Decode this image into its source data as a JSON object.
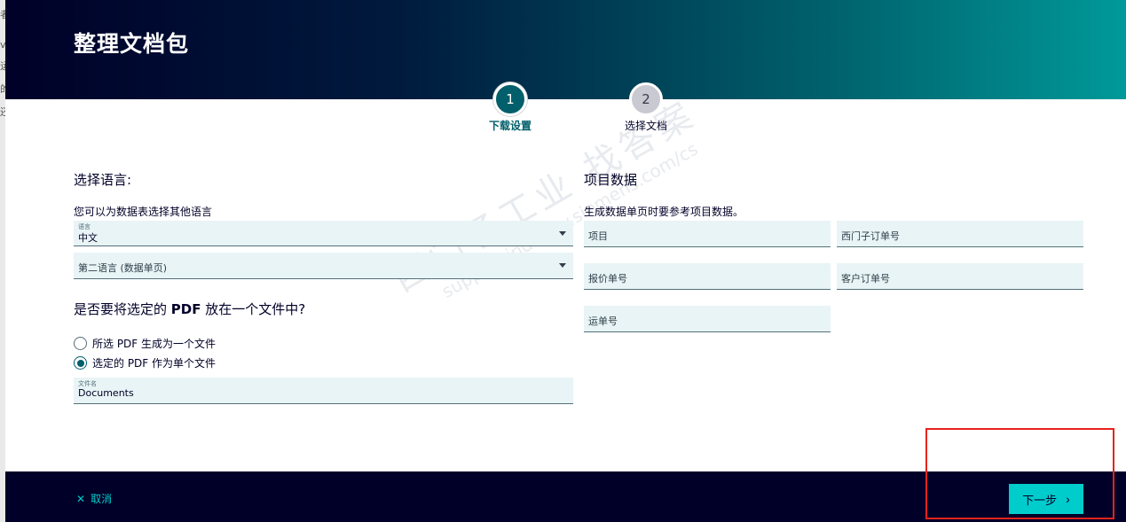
{
  "background_page": {
    "fragments": [
      "者",
      "v",
      "运",
      "的",
      "还"
    ]
  },
  "header": {
    "title": "整理文档包"
  },
  "stepper": {
    "steps": [
      {
        "number": "1",
        "label": "下载设置"
      },
      {
        "number": "2",
        "label": "选择文档"
      }
    ]
  },
  "language": {
    "title": "选择语言:",
    "hint": "您可以为数据表选择其他语言",
    "language_field": {
      "label": "语言",
      "value": "中文"
    },
    "second_language_field": {
      "placeholder": "第二语言 (数据单页)"
    }
  },
  "pdf": {
    "title_before": "是否要将选定的 ",
    "title_bold": "PDF",
    "title_after": " 放在一个文件中?",
    "options": [
      {
        "label": "所选 PDF 生成为一个文件",
        "checked": false
      },
      {
        "label": "选定的 PDF 作为单个文件",
        "checked": true
      }
    ],
    "filename_field": {
      "label": "文件名",
      "value": "Documents"
    }
  },
  "project": {
    "title": "项目数据",
    "hint": "生成数据单页时要参考项目数据。",
    "fields": {
      "project": "项目",
      "siemens_order": "西门子订单号",
      "quote": "报价单号",
      "customer_order": "客户订单号",
      "waybill": "运单号"
    }
  },
  "watermark": {
    "line1": "西门子工业 找答案",
    "line2": "support.industry.siemens.com/cs"
  },
  "footer": {
    "cancel_label": "取消",
    "next_label": "下一步"
  },
  "colors": {
    "accent": "#00cccc",
    "primary": "#005f6b",
    "dark": "#000028",
    "highlight": "#e8221c"
  }
}
